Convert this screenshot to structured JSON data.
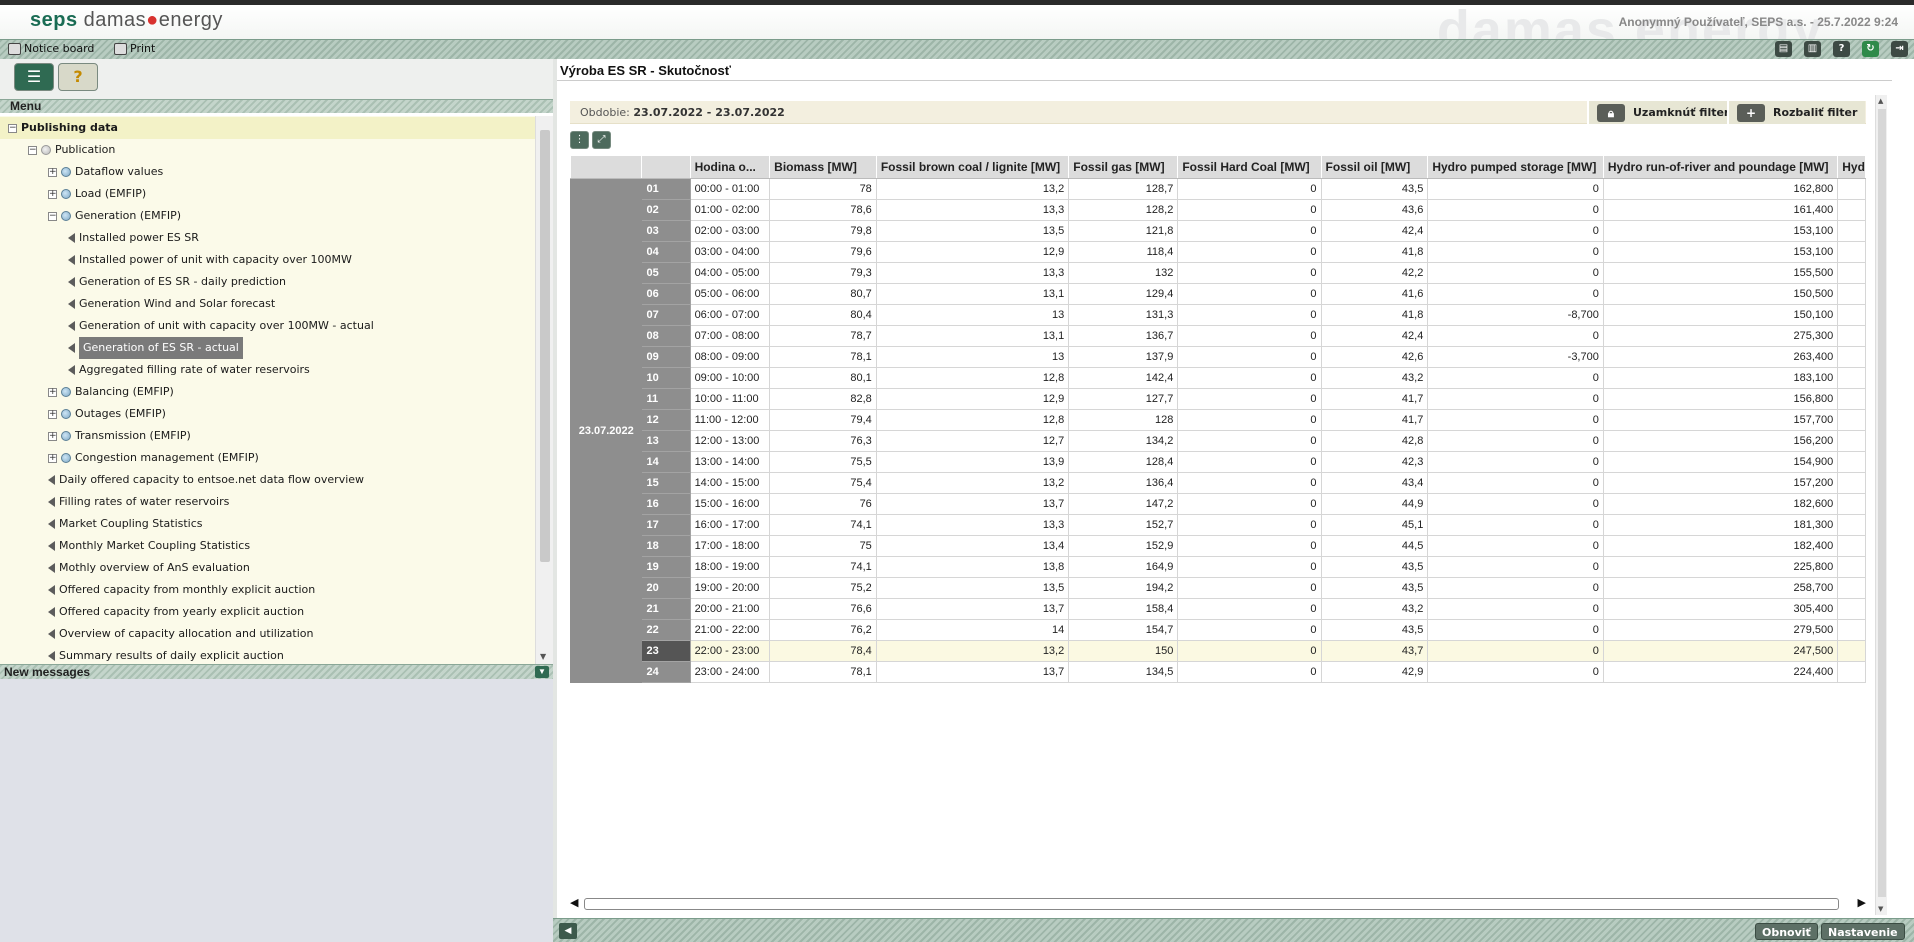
{
  "header": {
    "logo_seps": "seps",
    "logo_damas_prefix": "damas",
    "logo_damas_suffix": "energy",
    "watermark": "damas energy",
    "user_info": "Anonymný Používateľ, SEPS a.s. - 25.7.2022 9:24"
  },
  "toolbar": {
    "notice_board": "Notice board",
    "print": "Print"
  },
  "left_panel": {
    "menu_title": "Menu",
    "new_messages": "New messages",
    "tree": [
      {
        "label": "Publishing data",
        "level": 0,
        "type": "group",
        "expanded": true
      },
      {
        "label": "Publication",
        "level": 1,
        "type": "folder",
        "expanded": true
      },
      {
        "label": "Dataflow values",
        "level": 2,
        "type": "folder",
        "expanded": false
      },
      {
        "label": "Load (EMFIP)",
        "level": 2,
        "type": "folder",
        "expanded": false
      },
      {
        "label": "Generation (EMFIP)",
        "level": 2,
        "type": "folder",
        "expanded": true
      },
      {
        "label": "Installed power ES SR",
        "level": 3,
        "type": "leaf"
      },
      {
        "label": "Installed power of unit with capacity over 100MW",
        "level": 3,
        "type": "leaf"
      },
      {
        "label": "Generation of ES SR - daily prediction",
        "level": 3,
        "type": "leaf"
      },
      {
        "label": "Generation Wind and Solar forecast",
        "level": 3,
        "type": "leaf"
      },
      {
        "label": "Generation of unit with capacity over 100MW - actual",
        "level": 3,
        "type": "leaf"
      },
      {
        "label": "Generation of ES SR - actual",
        "level": 3,
        "type": "leaf",
        "selected": true
      },
      {
        "label": "Aggregated filling rate of water reservoirs",
        "level": 3,
        "type": "leaf"
      },
      {
        "label": "Balancing (EMFIP)",
        "level": 2,
        "type": "folder",
        "expanded": false
      },
      {
        "label": "Outages (EMFIP)",
        "level": 2,
        "type": "folder",
        "expanded": false
      },
      {
        "label": "Transmission (EMFIP)",
        "level": 2,
        "type": "folder",
        "expanded": false
      },
      {
        "label": "Congestion management (EMFIP)",
        "level": 2,
        "type": "folder",
        "expanded": false
      },
      {
        "label": "Daily offered capacity to entsoe.net data flow overview",
        "level": 2,
        "type": "leaf"
      },
      {
        "label": "Filling rates of water reservoirs",
        "level": 2,
        "type": "leaf"
      },
      {
        "label": "Market Coupling Statistics",
        "level": 2,
        "type": "leaf"
      },
      {
        "label": "Monthly Market Coupling Statistics",
        "level": 2,
        "type": "leaf"
      },
      {
        "label": "Mothly overview of AnS evaluation",
        "level": 2,
        "type": "leaf"
      },
      {
        "label": "Offered capacity from monthly explicit auction",
        "level": 2,
        "type": "leaf"
      },
      {
        "label": "Offered capacity from yearly explicit auction",
        "level": 2,
        "type": "leaf"
      },
      {
        "label": "Overview of capacity allocation and utilization",
        "level": 2,
        "type": "leaf"
      },
      {
        "label": "Summary results of daily explicit auction",
        "level": 2,
        "type": "leaf"
      }
    ]
  },
  "main": {
    "title": "Výroba ES SR - Skutočnosť",
    "filter_label": "Obdobie:",
    "filter_value": "23.07.2022 - 23.07.2022",
    "lock_filter": "Uzamknúť filter",
    "expand_filter": "Rozbaliť filter",
    "refresh_button": "Obnoviť",
    "settings_button": "Nastavenie",
    "date": "23.07.2022",
    "highlight_row": 23,
    "columns": [
      "Hodina o...",
      "Biomass [MW]",
      "Fossil brown coal / lignite [MW]",
      "Fossil gas [MW]",
      "Fossil Hard Coal [MW]",
      "Fossil oil [MW]",
      "Hydro pumped storage [MW]",
      "Hydro run-of-river and poundage [MW]",
      "Hyd"
    ],
    "rows": [
      [
        "01",
        "00:00 - 01:00",
        "78",
        "13,2",
        "128,7",
        "0",
        "43,5",
        "0",
        "162,800"
      ],
      [
        "02",
        "01:00 - 02:00",
        "78,6",
        "13,3",
        "128,2",
        "0",
        "43,6",
        "0",
        "161,400"
      ],
      [
        "03",
        "02:00 - 03:00",
        "79,8",
        "13,5",
        "121,8",
        "0",
        "42,4",
        "0",
        "153,100"
      ],
      [
        "04",
        "03:00 - 04:00",
        "79,6",
        "12,9",
        "118,4",
        "0",
        "41,8",
        "0",
        "153,100"
      ],
      [
        "05",
        "04:00 - 05:00",
        "79,3",
        "13,3",
        "132",
        "0",
        "42,2",
        "0",
        "155,500"
      ],
      [
        "06",
        "05:00 - 06:00",
        "80,7",
        "13,1",
        "129,4",
        "0",
        "41,6",
        "0",
        "150,500"
      ],
      [
        "07",
        "06:00 - 07:00",
        "80,4",
        "13",
        "131,3",
        "0",
        "41,8",
        "-8,700",
        "150,100"
      ],
      [
        "08",
        "07:00 - 08:00",
        "78,7",
        "13,1",
        "136,7",
        "0",
        "42,4",
        "0",
        "275,300"
      ],
      [
        "09",
        "08:00 - 09:00",
        "78,1",
        "13",
        "137,9",
        "0",
        "42,6",
        "-3,700",
        "263,400"
      ],
      [
        "10",
        "09:00 - 10:00",
        "80,1",
        "12,8",
        "142,4",
        "0",
        "43,2",
        "0",
        "183,100"
      ],
      [
        "11",
        "10:00 - 11:00",
        "82,8",
        "12,9",
        "127,7",
        "0",
        "41,7",
        "0",
        "156,800"
      ],
      [
        "12",
        "11:00 - 12:00",
        "79,4",
        "12,8",
        "128",
        "0",
        "41,7",
        "0",
        "157,700"
      ],
      [
        "13",
        "12:00 - 13:00",
        "76,3",
        "12,7",
        "134,2",
        "0",
        "42,8",
        "0",
        "156,200"
      ],
      [
        "14",
        "13:00 - 14:00",
        "75,5",
        "13,9",
        "128,4",
        "0",
        "42,3",
        "0",
        "154,900"
      ],
      [
        "15",
        "14:00 - 15:00",
        "75,4",
        "13,2",
        "136,4",
        "0",
        "43,4",
        "0",
        "157,200"
      ],
      [
        "16",
        "15:00 - 16:00",
        "76",
        "13,7",
        "147,2",
        "0",
        "44,9",
        "0",
        "182,600"
      ],
      [
        "17",
        "16:00 - 17:00",
        "74,1",
        "13,3",
        "152,7",
        "0",
        "45,1",
        "0",
        "181,300"
      ],
      [
        "18",
        "17:00 - 18:00",
        "75",
        "13,4",
        "152,9",
        "0",
        "44,5",
        "0",
        "182,400"
      ],
      [
        "19",
        "18:00 - 19:00",
        "74,1",
        "13,8",
        "164,9",
        "0",
        "43,5",
        "0",
        "225,800"
      ],
      [
        "20",
        "19:00 - 20:00",
        "75,2",
        "13,5",
        "194,2",
        "0",
        "43,5",
        "0",
        "258,700"
      ],
      [
        "21",
        "20:00 - 21:00",
        "76,6",
        "13,7",
        "158,4",
        "0",
        "43,2",
        "0",
        "305,400"
      ],
      [
        "22",
        "21:00 - 22:00",
        "76,2",
        "14",
        "154,7",
        "0",
        "43,5",
        "0",
        "279,500"
      ],
      [
        "23",
        "22:00 - 23:00",
        "78,4",
        "13,2",
        "150",
        "0",
        "43,7",
        "0",
        "247,500"
      ],
      [
        "24",
        "23:00 - 24:00",
        "78,1",
        "13,7",
        "134,5",
        "0",
        "42,9",
        "0",
        "224,400"
      ]
    ]
  }
}
